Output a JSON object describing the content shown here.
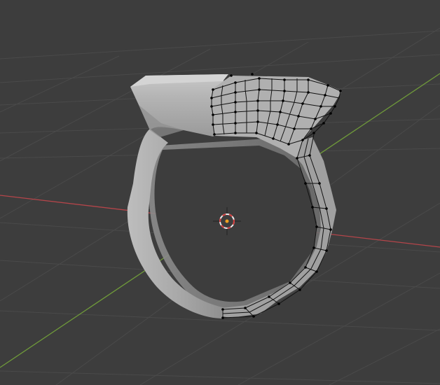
{
  "viewport": {
    "mode": "3d-viewport-edit-mode",
    "background_color": "#3d3d3d",
    "grid_color": "#4a4a4a",
    "x_axis_color": "#b4454a",
    "y_axis_color": "#6f9a3a",
    "mesh_fill_color": "#a4a4a4",
    "wire_color": "#111111",
    "vertex_color": "#000000",
    "cursor_colors": {
      "ring_red": "#d23c3c",
      "ring_white": "#eeeeee",
      "center": "#f0a020"
    }
  },
  "scene_objects": [
    {
      "name": "ring-mesh",
      "type": "mesh",
      "state": "edit-mode, partially selected wireframe"
    },
    {
      "name": "3d-cursor",
      "type": "cursor"
    }
  ]
}
